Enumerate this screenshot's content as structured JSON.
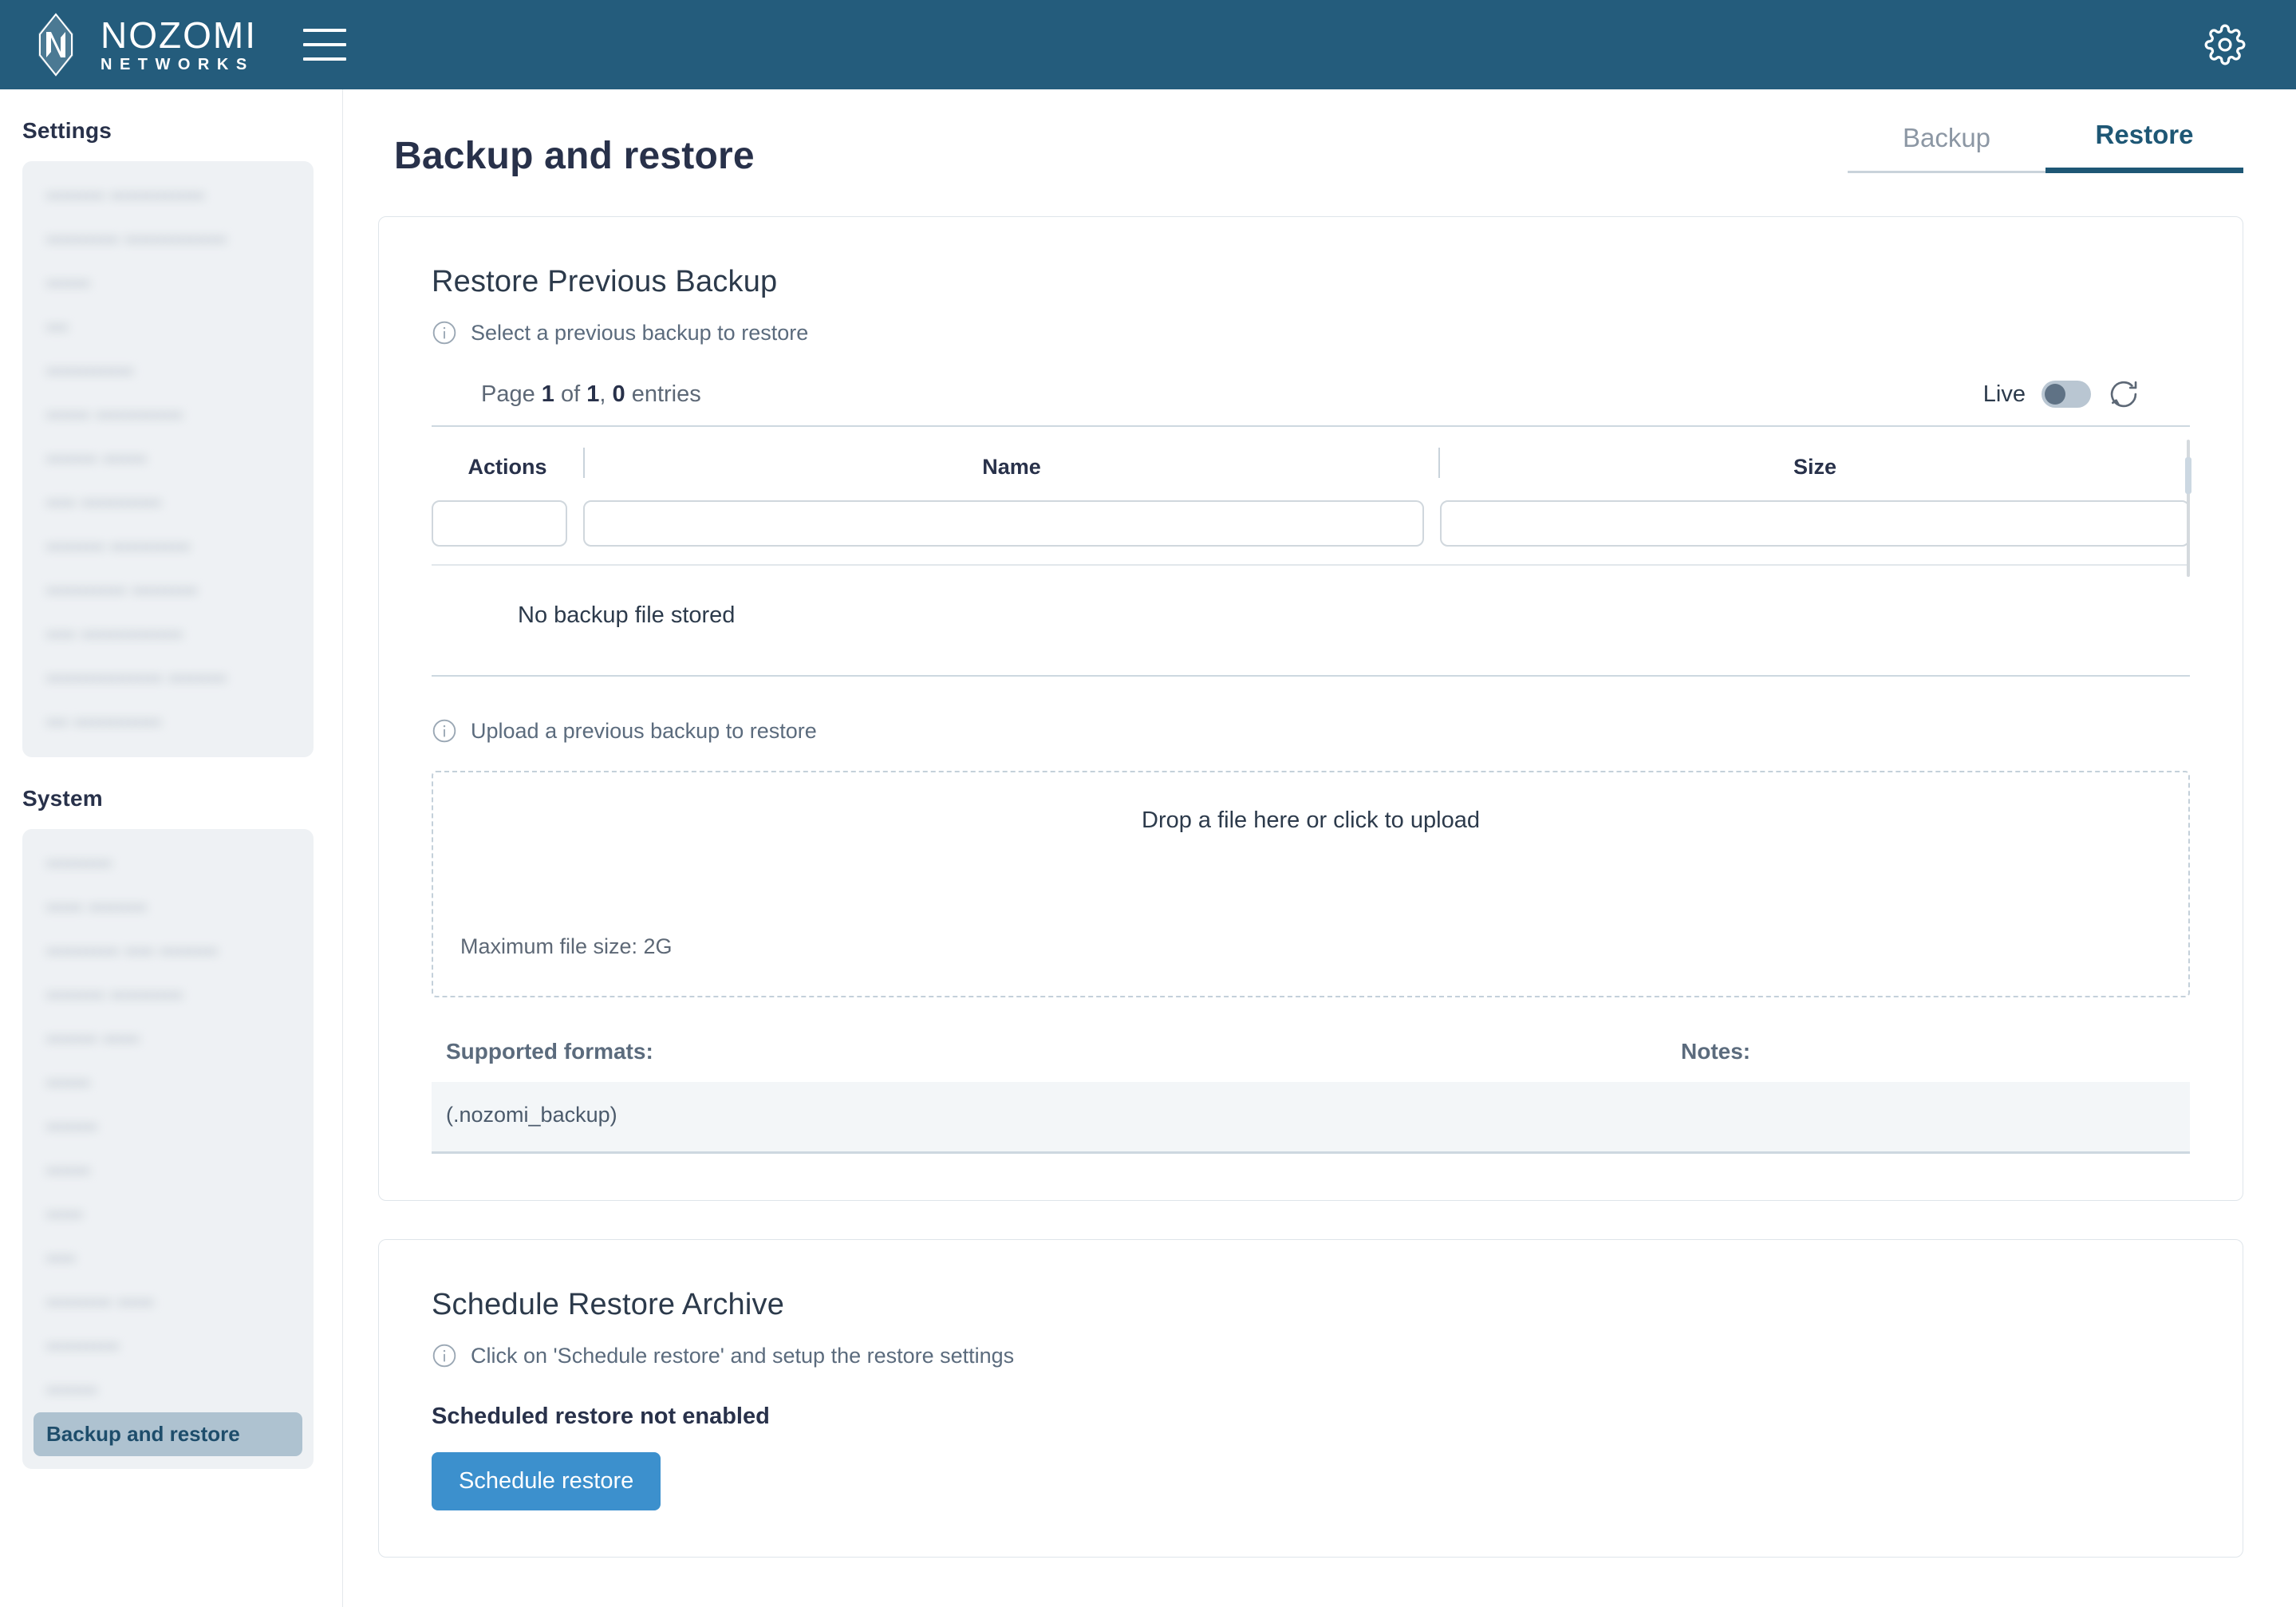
{
  "header": {
    "brand_top": "NOZOMI",
    "brand_bottom": "NETWORKS",
    "menu_icon": "hamburger-menu-icon",
    "settings_icon": "gear-icon",
    "bg_color": "#245c7c"
  },
  "sidebar": {
    "groups": [
      {
        "heading": "Settings",
        "items": [
          {
            "label": "•••••••• •••••••••••••",
            "redacted": true,
            "active": false
          },
          {
            "label": "•••••••••• ••••••••••••••",
            "redacted": true,
            "active": false
          },
          {
            "label": "••••••",
            "redacted": true,
            "active": false
          },
          {
            "label": "•••",
            "redacted": true,
            "active": false
          },
          {
            "label": "••••••••••••",
            "redacted": true,
            "active": false
          },
          {
            "label": "•••••• ••••••••••••",
            "redacted": true,
            "active": false
          },
          {
            "label": "••••••• ••••••",
            "redacted": true,
            "active": false
          },
          {
            "label": "•••• •••••••••••",
            "redacted": true,
            "active": false
          },
          {
            "label": "•••••••• •••••••••••",
            "redacted": true,
            "active": false
          },
          {
            "label": "••••••••••• •••••••••",
            "redacted": true,
            "active": false
          },
          {
            "label": "•••• ••••••••••••••",
            "redacted": true,
            "active": false
          },
          {
            "label": "•••••••••••••••• ••••••••",
            "redacted": true,
            "active": false
          },
          {
            "label": "••• ••••••••••••",
            "redacted": true,
            "active": false
          }
        ]
      },
      {
        "heading": "System",
        "items": [
          {
            "label": "•••••••••",
            "redacted": true,
            "active": false
          },
          {
            "label": "••••• ••••••••",
            "redacted": true,
            "active": false
          },
          {
            "label": "•••••••••• •••• ••••••••",
            "redacted": true,
            "active": false
          },
          {
            "label": "•••••••• ••••••••••",
            "redacted": true,
            "active": false
          },
          {
            "label": "••••••• •••••",
            "redacted": true,
            "active": false
          },
          {
            "label": "••••••",
            "redacted": true,
            "active": false
          },
          {
            "label": "•••••••",
            "redacted": true,
            "active": false
          },
          {
            "label": "••••••",
            "redacted": true,
            "active": false
          },
          {
            "label": "•••••",
            "redacted": true,
            "active": false
          },
          {
            "label": "••••",
            "redacted": true,
            "active": false
          },
          {
            "label": "••••••••• •••••",
            "redacted": true,
            "active": false
          },
          {
            "label": "••••••••••",
            "redacted": true,
            "active": false
          },
          {
            "label": "•••••••",
            "redacted": true,
            "active": false
          },
          {
            "label": "Backup and restore",
            "redacted": false,
            "active": true
          }
        ]
      }
    ]
  },
  "page": {
    "title": "Backup and restore",
    "tabs": [
      {
        "label": "Backup",
        "active": false
      },
      {
        "label": "Restore",
        "active": true
      }
    ]
  },
  "restore_card": {
    "title": "Restore Previous Backup",
    "select_hint": "Select a previous backup to restore",
    "info_icon": "info-circle-icon",
    "table": {
      "pager_prefix": "Page ",
      "page_current": "1",
      "pager_mid": " of ",
      "page_total": "1",
      "pager_sep": ", ",
      "entries_count": "0",
      "entries_suffix": " entries",
      "live_label": "Live",
      "live_on": false,
      "refresh_icon": "refresh-icon",
      "columns": [
        "Actions",
        "Name",
        "Size"
      ],
      "filter_values": [
        "",
        "",
        ""
      ],
      "rows": [],
      "empty_message": "No backup file stored"
    },
    "upload_hint": "Upload a previous backup to restore",
    "dropzone_label": "Drop a file here or click to upload",
    "max_file_size": "Maximum file size: 2G",
    "formats_header": "Supported formats:",
    "notes_header": "Notes:",
    "formats_value": "(.nozomi_backup)",
    "notes_value": ""
  },
  "schedule_card": {
    "title": "Schedule Restore Archive",
    "hint": "Click on 'Schedule restore' and setup the restore settings",
    "info_icon": "info-circle-icon",
    "status": "Scheduled restore not enabled",
    "button_label": "Schedule restore",
    "button_color": "#3c90cd"
  }
}
